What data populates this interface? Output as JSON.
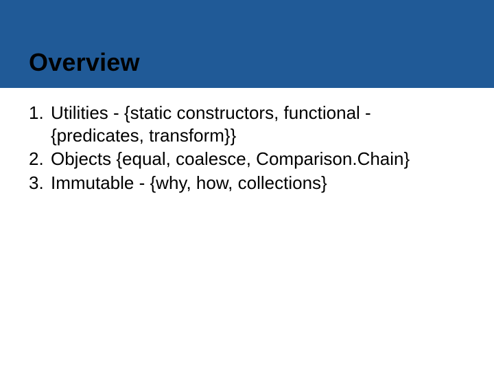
{
  "slide": {
    "title": "Overview",
    "items": [
      "Utilities - {static constructors, functional - {predicates, transform}}",
      "Objects {equal, coalesce, Comparison.Chain}",
      "Immutable - {why, how, collections}"
    ]
  }
}
